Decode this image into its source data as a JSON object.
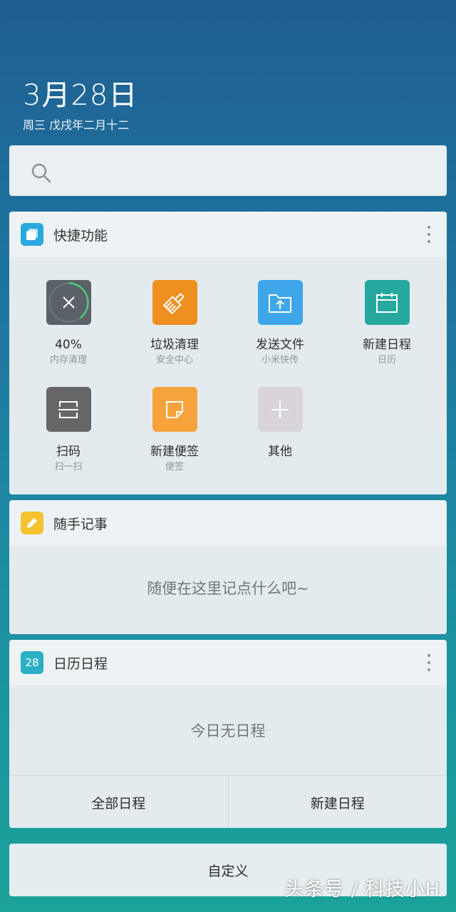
{
  "header": {
    "date": "3月28日",
    "subtitle": "周三 戊戌年二月十二"
  },
  "search": {
    "icon": "search-icon"
  },
  "quick_functions": {
    "title": "快捷功能",
    "icon": "quick-functions-icon",
    "menu_icon": "more-vert-icon",
    "items": [
      {
        "label": "40%",
        "sub": "内存清理",
        "icon": "memory-clean-icon",
        "color": "#5b6168",
        "progress": 0.4
      },
      {
        "label": "垃圾清理",
        "sub": "安全中心",
        "icon": "broom-icon",
        "color": "#ef8f1f"
      },
      {
        "label": "发送文件",
        "sub": "小米快传",
        "icon": "folder-upload-icon",
        "color": "#3ea7ea"
      },
      {
        "label": "新建日程",
        "sub": "日历",
        "icon": "calendar-icon",
        "color": "#26a89e"
      },
      {
        "label": "扫码",
        "sub": "扫一扫",
        "icon": "scan-icon",
        "color": "#666666"
      },
      {
        "label": "新建便签",
        "sub": "便签",
        "icon": "note-icon",
        "color": "#f6a33b"
      },
      {
        "label": "其他",
        "sub": "",
        "icon": "plus-icon",
        "color": "#d9d4dc"
      }
    ]
  },
  "notes": {
    "title": "随手记事",
    "icon": "pencil-icon",
    "placeholder": "随便在这里记点什么吧~"
  },
  "calendar": {
    "title": "日历日程",
    "icon_text": "28",
    "icon": "calendar-day-icon",
    "menu_icon": "more-vert-icon",
    "empty_text": "今日无日程",
    "all_button": "全部日程",
    "new_button": "新建日程"
  },
  "footer": {
    "customize": "自定义",
    "watermark": "头条号 / 科技小H"
  },
  "colors": {
    "background_top": "#1f5f93",
    "background_bottom": "#1aa39a",
    "quick_icon": "#29a8e0",
    "note_icon": "#f5c230",
    "calendar_icon": "#2bb0c4"
  }
}
